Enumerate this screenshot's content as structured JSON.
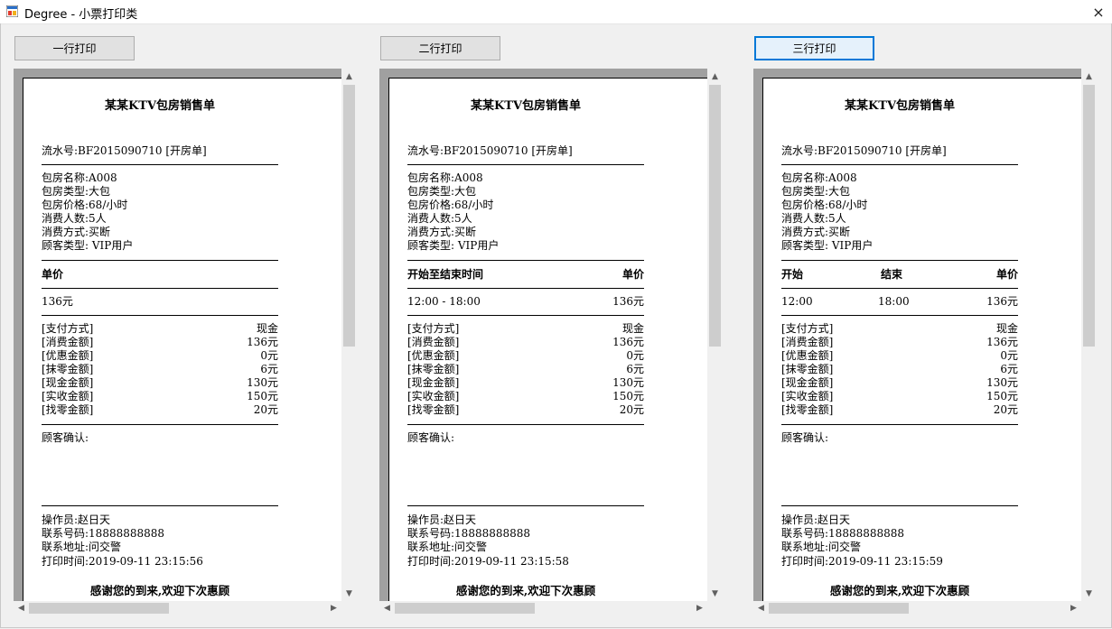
{
  "window": {
    "title": "Degree - 小票打印类",
    "close_icon": "×"
  },
  "buttons": [
    {
      "label": "一行打印"
    },
    {
      "label": "二行打印"
    },
    {
      "label": "三行打印"
    }
  ],
  "receipt_common": {
    "title": "某某KTV包房销售单",
    "serial": "流水号:BF2015090710 [开房单]",
    "info": [
      "包房名称:A008",
      "包房类型:大包",
      "包房价格:68/小时",
      "消费人数:5人",
      "消费方式:买断",
      "顾客类型: VIP用户"
    ],
    "payments": [
      {
        "label": "[支付方式]",
        "value": "现金"
      },
      {
        "label": "[消费金额]",
        "value": "136元"
      },
      {
        "label": "[优惠金额]",
        "value": "0元"
      },
      {
        "label": "[抹零金额]",
        "value": "6元"
      },
      {
        "label": "[现金金额]",
        "value": "130元"
      },
      {
        "label": "[实收金额]",
        "value": "150元"
      },
      {
        "label": "[找零金额]",
        "value": "20元"
      }
    ],
    "confirm": "顾客确认:",
    "operator": "操作员:赵日天",
    "phone": "联系号码:18888888888",
    "address": "联系地址:问交警",
    "thanks": "感谢您的到来,欢迎下次惠顾"
  },
  "receipts": [
    {
      "header": {
        "col1": "单价"
      },
      "values": {
        "col1": "136元"
      },
      "print_time": "打印时间:2019-09-11 23:15:56"
    },
    {
      "header": {
        "col1": "开始至结束时间",
        "col2": "单价"
      },
      "values": {
        "col1": "12:00 - 18:00",
        "col2": "136元"
      },
      "print_time": "打印时间:2019-09-11 23:15:58"
    },
    {
      "header": {
        "col1": "开始",
        "col2": "结束",
        "col3": "单价"
      },
      "values": {
        "col1": "12:00",
        "col2": "18:00",
        "col3": "136元"
      },
      "print_time": "打印时间:2019-09-11 23:15:59"
    }
  ],
  "scroll": {
    "up_icon": "▲",
    "down_icon": "▼",
    "left_icon": "◀",
    "right_icon": "▶"
  }
}
